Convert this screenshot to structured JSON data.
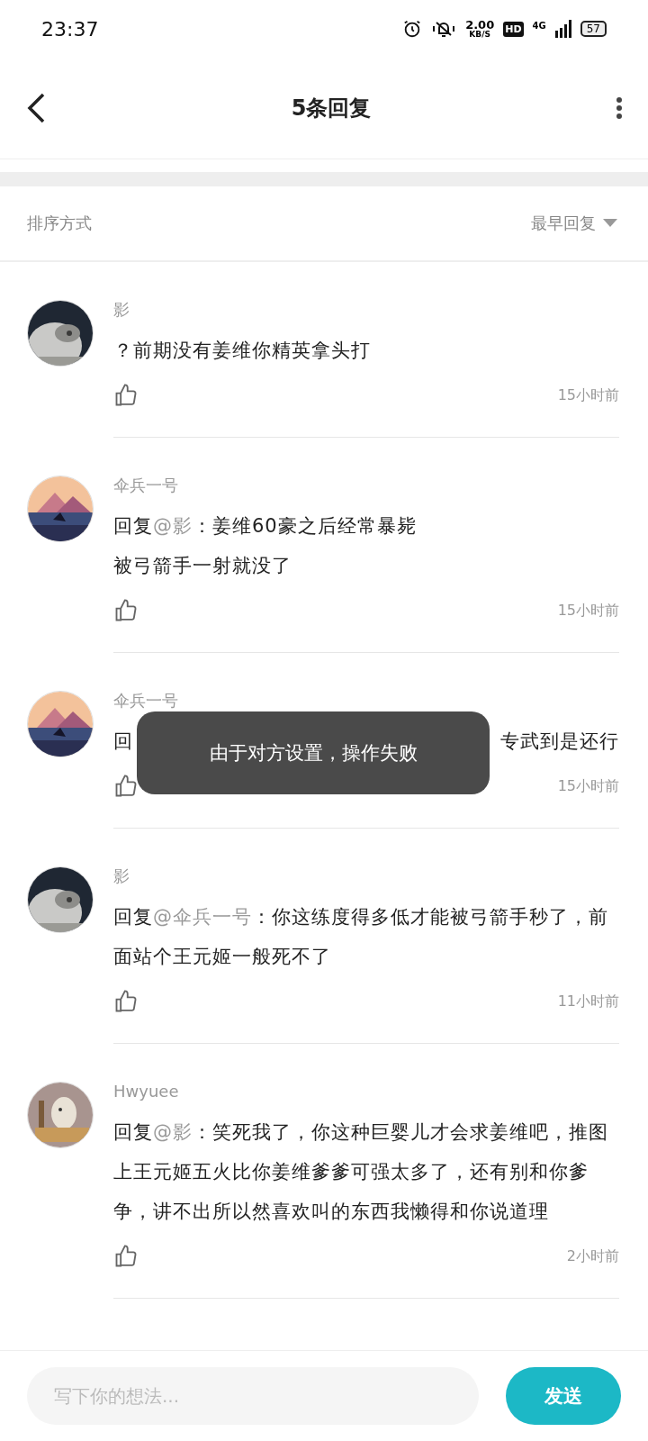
{
  "status_bar": {
    "time": "23:37",
    "speed_value": "2.00",
    "speed_unit": "KB/S",
    "hd": "HD",
    "network": "4G",
    "battery": "57"
  },
  "header": {
    "title": "5条回复"
  },
  "sort": {
    "label": "排序方式",
    "value": "最早回复"
  },
  "comments": [
    {
      "kind": "plain",
      "author": "影",
      "body": "？前期没有姜维你精英拿头打",
      "time": "15小时前"
    },
    {
      "kind": "reply",
      "author": "伞兵一号",
      "prefix": "回复",
      "reply_to": "@影",
      "body": "：姜维60豪之后经常暴毙",
      "more_lines": [
        "被弓箭手一射就没了"
      ],
      "time": "15小时前"
    },
    {
      "kind": "covered",
      "author": "伞兵一号",
      "fragments": [
        "回",
        "专武到是还行"
      ],
      "time": "15小时前"
    },
    {
      "kind": "reply",
      "author": "影",
      "prefix": "回复",
      "reply_to": "@伞兵一号",
      "body": "：你这练度得多低才能被弓箭手秒了，前面站个王元姬一般死不了",
      "time": "11小时前"
    },
    {
      "kind": "reply",
      "author": "Hwyuee",
      "prefix": "回复",
      "reply_to": "@影",
      "body": "：笑死我了，你这种巨婴儿才会求姜维吧，推图上王元姬五火比你姜维爹爹可强太多了，还有别和你爹争，讲不出所以然喜欢叫的东西我懒得和你说道理",
      "time": "2小时前"
    }
  ],
  "toast": {
    "message": "由于对方设置，操作失败"
  },
  "composer": {
    "placeholder": "写下你的想法...",
    "send": "发送"
  }
}
